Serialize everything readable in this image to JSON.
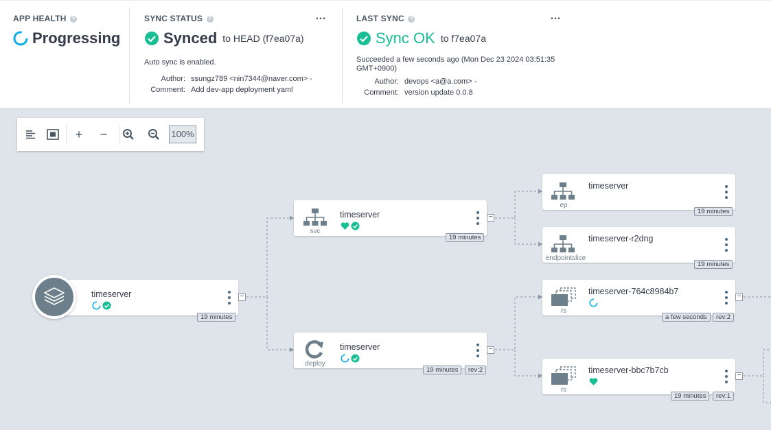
{
  "app_health": {
    "title": "APP HEALTH",
    "status": "Progressing",
    "help_icon": "?"
  },
  "sync_status": {
    "title": "SYNC STATUS",
    "status": "Synced",
    "target": "to HEAD (f7ea07a)",
    "auto_sync": "Auto sync is enabled.",
    "author_label": "Author:",
    "author": "ssungz789 <nin7344@naver.com> -",
    "comment_label": "Comment:",
    "comment": "Add dev-app deployment yaml",
    "menu": "…"
  },
  "last_sync": {
    "title": "LAST SYNC",
    "status": "Sync OK",
    "target": "to f7ea07a",
    "succeeded": "Succeeded a few seconds ago (Mon Dec 23 2024 03:51:35",
    "succeeded_2": "GMT+0900)",
    "author_label": "Author:",
    "author": "devops <a@a.com> -",
    "comment_label": "Comment:",
    "comment": "version update 0.0.8",
    "menu": "…"
  },
  "toolbar": {
    "zoom": "100%",
    "plus": "+",
    "minus": "−"
  },
  "colors": {
    "healthy_green": "#18be94",
    "progressing_blue": "#0dadea",
    "text": "#363c4a",
    "canvas_bg": "#dee4ea"
  },
  "nodes": {
    "app": {
      "name": "timeserver",
      "age": "19 minutes",
      "icon": "layers-icon"
    },
    "svc": {
      "name": "timeserver",
      "kind": "svc",
      "age": "19 minutes",
      "icon": "network-icon"
    },
    "deploy": {
      "name": "timeserver",
      "kind": "deploy",
      "age": "19 minutes",
      "rev": "rev:2",
      "icon": "refresh-icon"
    },
    "ep": {
      "name": "timeserver",
      "kind": "ep",
      "age": "19 minutes",
      "icon": "network-icon"
    },
    "endpointslice": {
      "name": "timeserver-r2dng",
      "kind": "endpointslice",
      "age": "19 minutes",
      "icon": "network-icon"
    },
    "rs1": {
      "name": "timeserver-764c8984b7",
      "kind": "rs",
      "age": "a few seconds",
      "rev": "rev:2",
      "icon": "copy-icon"
    },
    "rs2": {
      "name": "timeserver-bbc7b7cb",
      "kind": "rs",
      "age": "19 minutes",
      "rev": "rev:1",
      "icon": "copy-icon"
    }
  },
  "collapse_label": "−"
}
